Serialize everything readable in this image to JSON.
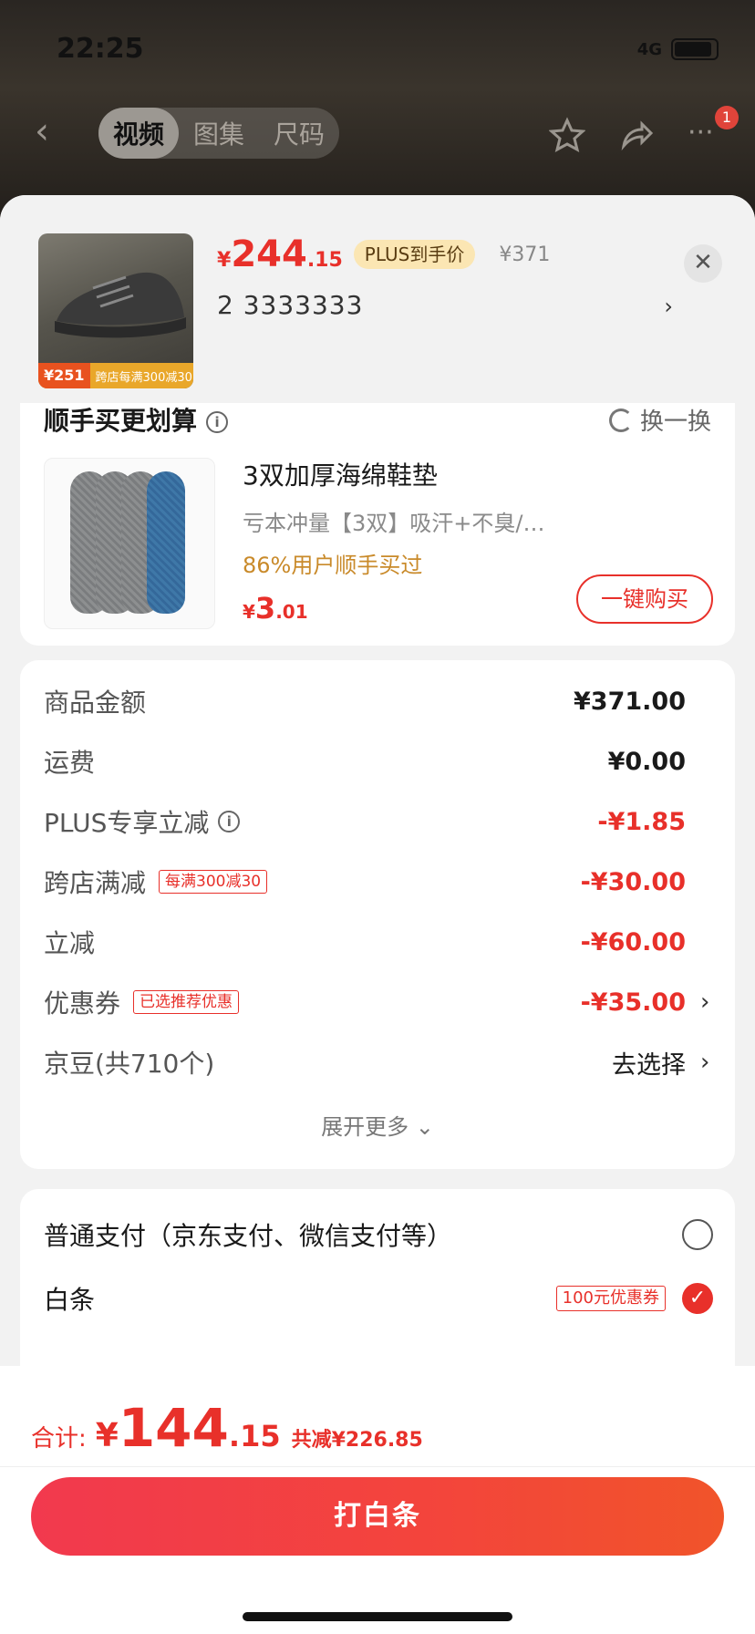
{
  "status_bar": {
    "time": "22:25",
    "network": "4G"
  },
  "nav": {
    "tabs": [
      {
        "label": "视频",
        "active": true
      },
      {
        "label": "图集",
        "active": false
      },
      {
        "label": "尺码",
        "active": false
      }
    ],
    "more_badge": "1"
  },
  "product": {
    "price_symbol": "¥",
    "price_int": "244",
    "price_dec": ".15",
    "plus_tag": "PLUS到手价",
    "original_price": "¥371",
    "sku": "2  3333333",
    "thumb_price": "¥251",
    "thumb_promo": "跨店每满300减30"
  },
  "addon": {
    "section_title": "顺手买更划算",
    "refresh_label": "换一换",
    "name": "3双加厚海绵鞋垫",
    "desc": "亏本冲量【3双】吸汗+不臭/…",
    "percent_text": "86%用户顺手买过",
    "price_symbol": "¥",
    "price_int": "3",
    "price_dec": ".01",
    "buy_label": "一键购买"
  },
  "breakdown": {
    "rows": [
      {
        "label": "商品金额",
        "value": "¥371.00"
      },
      {
        "label": "运费",
        "value": "¥0.00"
      },
      {
        "label": "PLUS专享立减",
        "value": "-¥1.85"
      },
      {
        "label": "跨店满减",
        "tag": "每满300减30",
        "value": "-¥30.00"
      },
      {
        "label": "立减",
        "value": "-¥60.00"
      },
      {
        "label": "优惠券",
        "tag": "已选推荐优惠",
        "value": "-¥35.00"
      },
      {
        "label": "京豆(共710个)",
        "value": "去选择"
      }
    ],
    "expand_label": "展开更多"
  },
  "payment": {
    "options": [
      {
        "label": "普通支付（京东支付、微信支付等）",
        "selected": false
      },
      {
        "label": "白条",
        "tag": "100元优惠券",
        "selected": true
      }
    ]
  },
  "footer": {
    "total_label": "合计:",
    "total_symbol": "¥",
    "total_int": "144",
    "total_dec": ".15",
    "saved_label": "共减¥226.85",
    "pay_button": "打白条"
  },
  "colors": {
    "accent": "#e8302a",
    "plus_tag_bg": "#fbe6b3",
    "percent": "#c98a2a"
  }
}
